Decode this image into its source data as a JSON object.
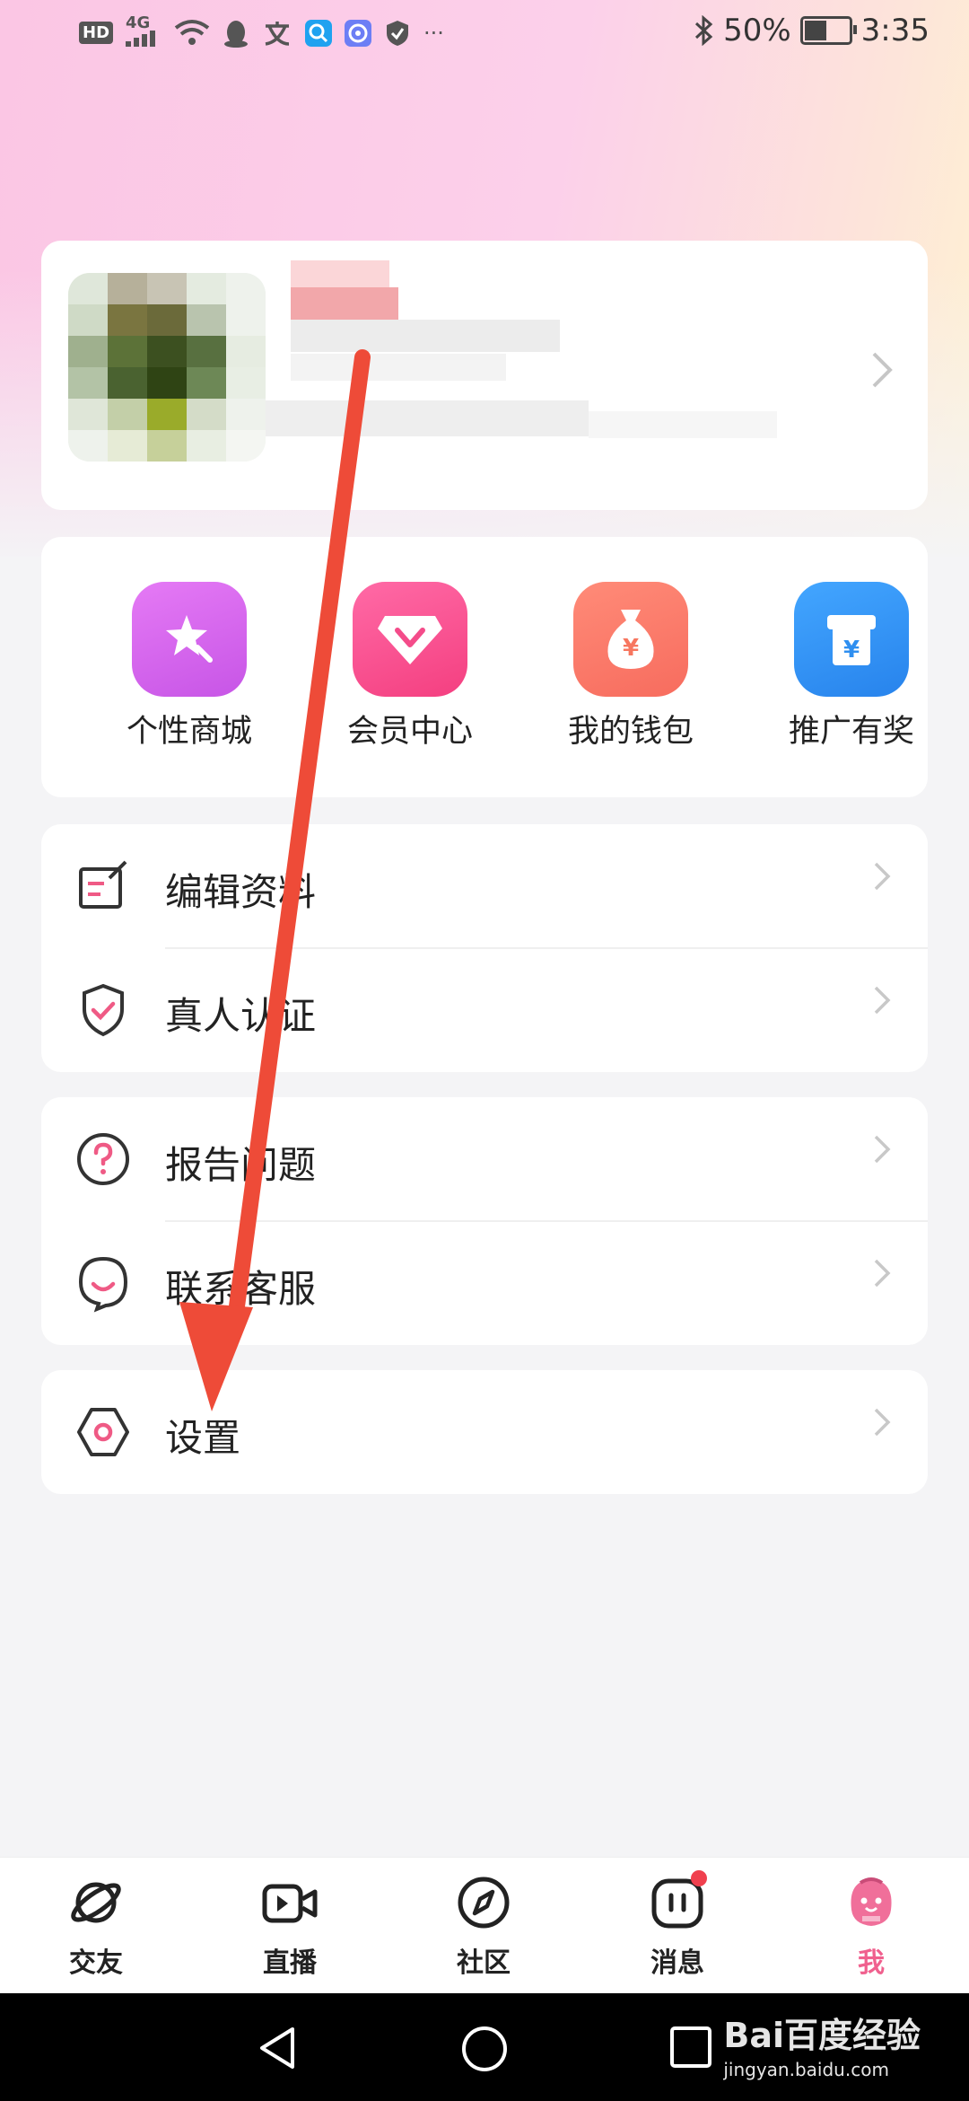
{
  "status_bar": {
    "battery": "50%",
    "time": "3:35",
    "network": "4G",
    "hd": "HD",
    "more": "···"
  },
  "profile": {},
  "quick_actions": [
    {
      "label": "个性商城",
      "icon": "star-wand-icon",
      "color": "#d46ef0"
    },
    {
      "label": "会员中心",
      "icon": "vip-diamond-icon",
      "color": "#fb4f8d"
    },
    {
      "label": "我的钱包",
      "icon": "money-bag-icon",
      "color": "#fb7a6b"
    },
    {
      "label": "推广有奖",
      "icon": "gift-box-icon",
      "color": "#2f8ff0"
    }
  ],
  "menu_group_1": [
    {
      "label": "编辑资料",
      "icon": "edit-icon"
    },
    {
      "label": "真人认证",
      "icon": "verified-shield-icon"
    }
  ],
  "menu_group_2": [
    {
      "label": "报告问题",
      "icon": "question-icon"
    },
    {
      "label": "联系客服",
      "icon": "customer-service-icon"
    }
  ],
  "menu_group_3": [
    {
      "label": "设置",
      "icon": "settings-icon"
    }
  ],
  "tabs": [
    {
      "label": "交友",
      "icon": "planet-icon",
      "active": false
    },
    {
      "label": "直播",
      "icon": "video-icon",
      "active": false
    },
    {
      "label": "社区",
      "icon": "compass-icon",
      "active": false
    },
    {
      "label": "消息",
      "icon": "message-icon",
      "active": false,
      "badge": true
    },
    {
      "label": "我",
      "icon": "me-avatar-icon",
      "active": true
    }
  ],
  "colors": {
    "accent": "#f0608e",
    "annotation_arrow": "#ee4b38"
  },
  "watermark": {
    "brand": "Bai百度经验",
    "url": "jingyan.baidu.com"
  }
}
